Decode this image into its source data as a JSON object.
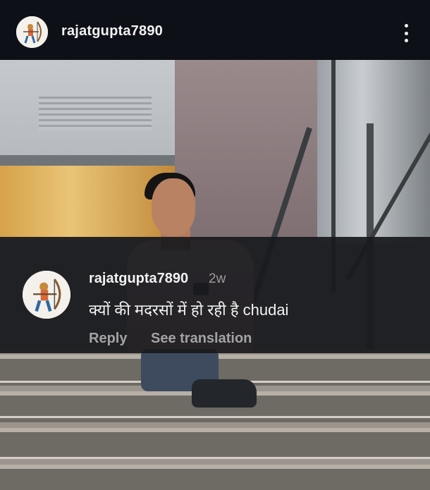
{
  "header": {
    "username": "rajatgupta7890",
    "avatar_icon": "archer-figure-avatar",
    "more_icon": "vertical-ellipsis-icon"
  },
  "comment": {
    "username": "rajatgupta7890",
    "time_ago": "2w",
    "text": "क्यों की मदरसों में हो रही है chudai",
    "reply_label": "Reply",
    "translate_label": "See translation",
    "avatar_icon": "archer-figure-avatar"
  },
  "colors": {
    "header_bg": "#0d1016",
    "comment_bg": "#1a1b1e",
    "text_primary": "#f2f2f2",
    "text_secondary": "#a3a3a3"
  }
}
